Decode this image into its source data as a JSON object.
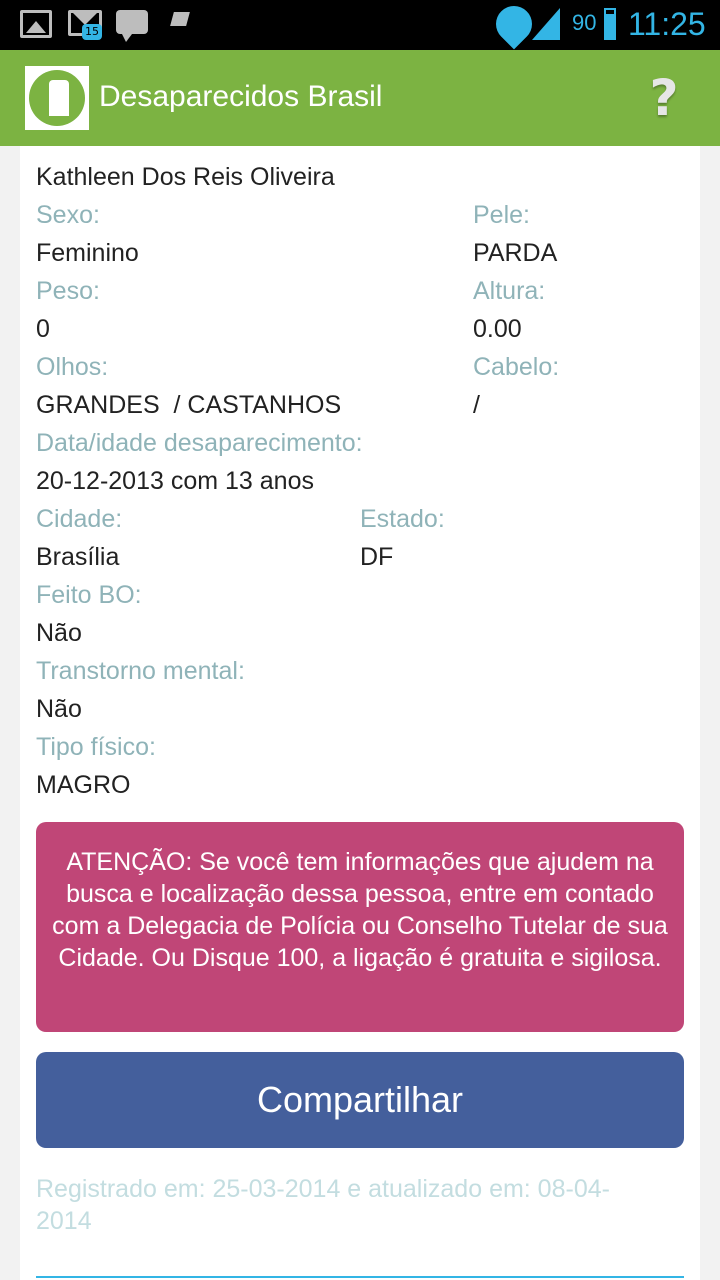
{
  "status_bar": {
    "notification_count": "15",
    "battery": "90",
    "time": "11:25",
    "icons": [
      "gallery-icon",
      "gmail-icon",
      "chat-icon",
      "flag-icon",
      "wifi-icon",
      "signal-icon",
      "battery-icon"
    ]
  },
  "action_bar": {
    "title": "Desaparecidos Brasil",
    "help": "?",
    "color": "#7cb342"
  },
  "person": {
    "name": "Kathleen Dos Reis Oliveira",
    "fields": {
      "sexo": {
        "label": "Sexo:",
        "value": "Feminino"
      },
      "pele": {
        "label": "Pele:",
        "value": "PARDA"
      },
      "peso": {
        "label": "Peso:",
        "value": "0"
      },
      "altura": {
        "label": "Altura:",
        "value": "0.00"
      },
      "olhos": {
        "label": "Olhos:",
        "value": "GRANDES  / CASTANHOS"
      },
      "cabelo": {
        "label": "Cabelo:",
        "value": "/"
      },
      "data": {
        "label": "Data/idade desaparecimento:",
        "value": "20-12-2013 com 13 anos"
      },
      "cidade": {
        "label": "Cidade:",
        "value": "Brasília"
      },
      "estado": {
        "label": "Estado:",
        "value": "DF"
      },
      "bo": {
        "label": "Feito BO:",
        "value": "Não"
      },
      "transtorno": {
        "label": "Transtorno mental:",
        "value": "Não"
      },
      "tipo": {
        "label": "Tipo físico:",
        "value": "MAGRO"
      }
    }
  },
  "alert": {
    "text": "ATENÇÃO: Se você tem informações que ajudem na busca e localização dessa pessoa, entre em contado com a Delegacia de Polícia ou Conselho Tutelar de sua Cidade. Ou Disque 100, a ligação é gratuita e sigilosa.",
    "color": "#c04677"
  },
  "share_button": {
    "label": "Compartilhar",
    "color": "#445f9c"
  },
  "footer": {
    "text": "Registrado em: 25-03-2014 e atualizado em: 08-04-2014"
  }
}
